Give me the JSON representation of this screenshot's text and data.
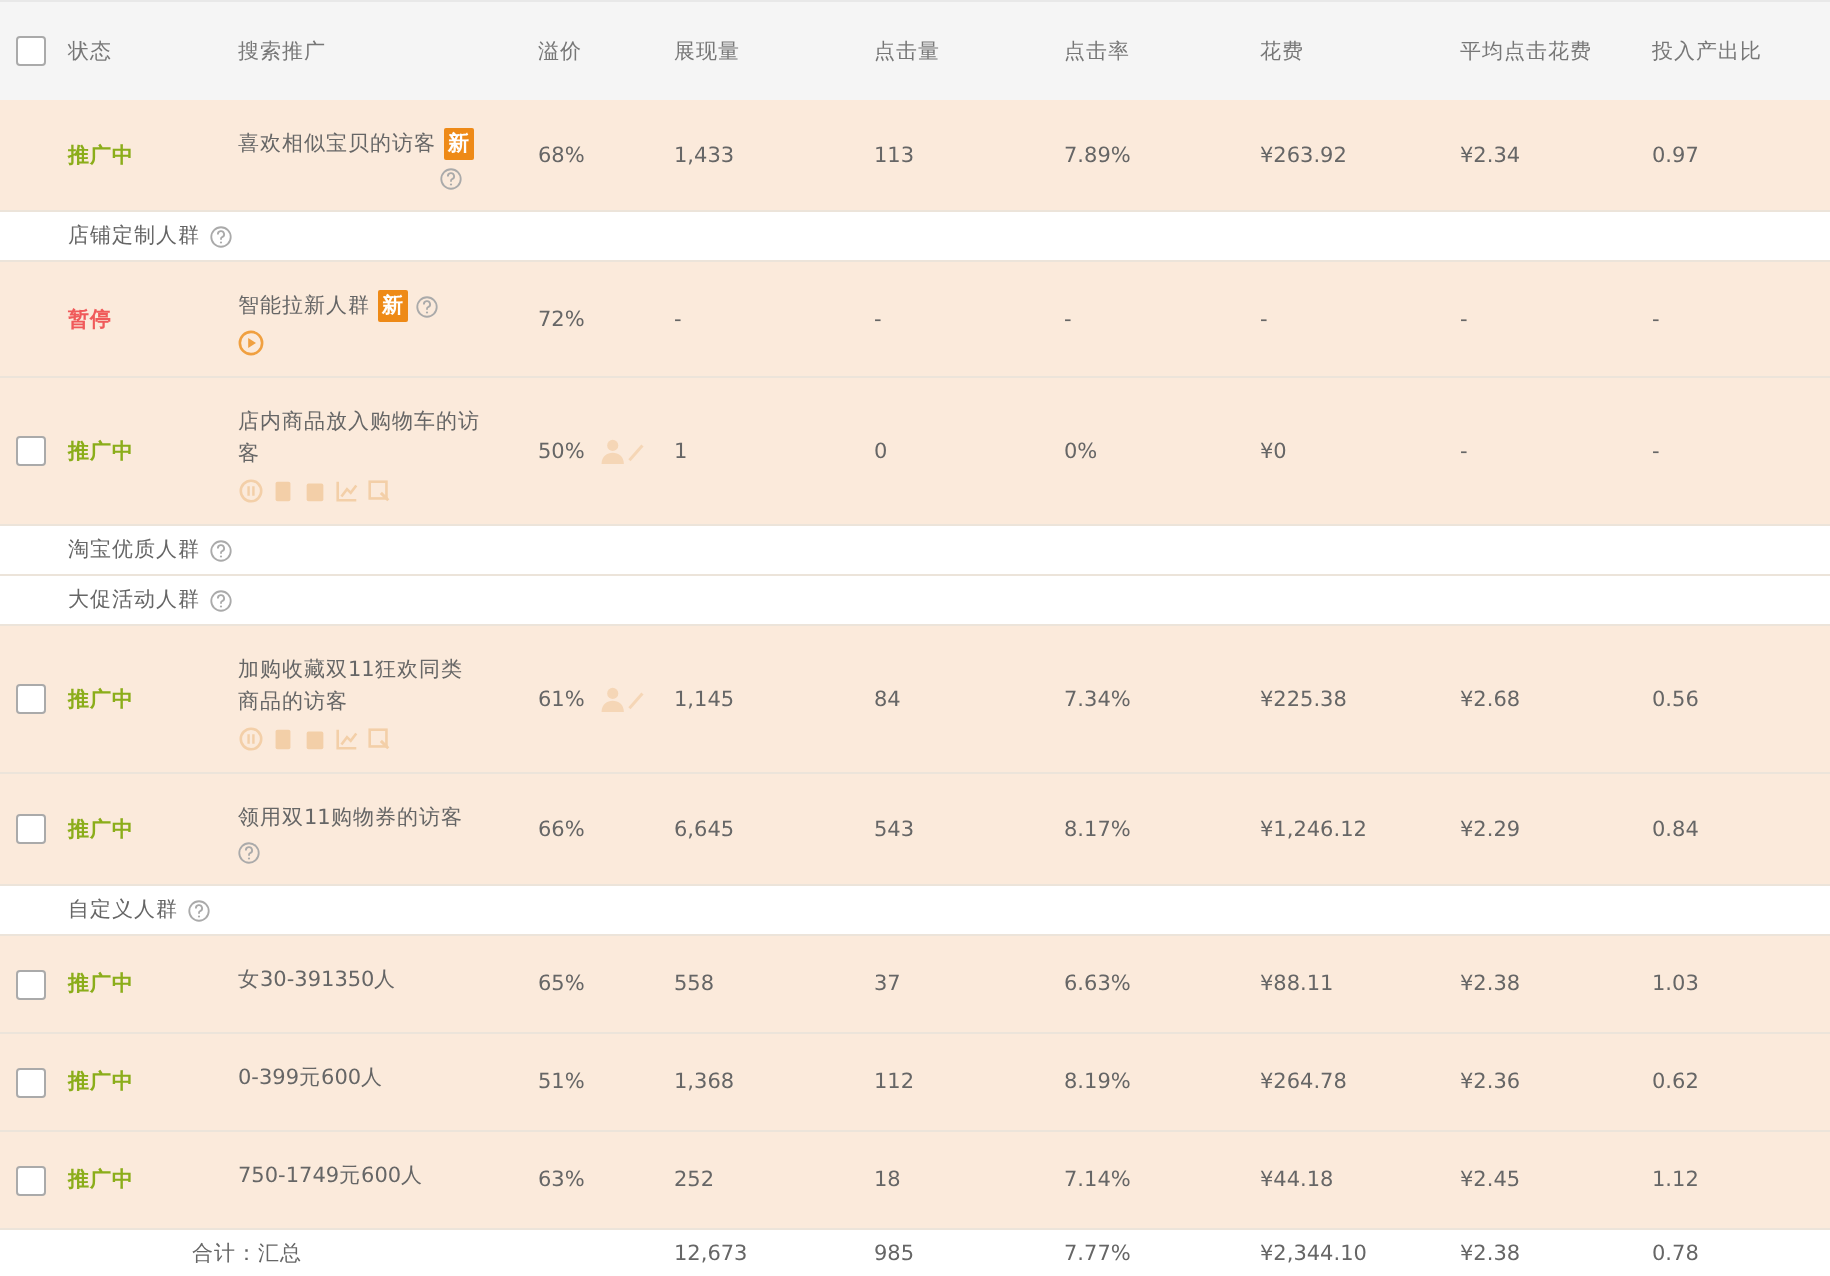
{
  "columns": [
    {
      "label": "状态"
    },
    {
      "label": "搜索推广"
    },
    {
      "label": "溢价"
    },
    {
      "label": "展现量"
    },
    {
      "label": "点击量"
    },
    {
      "label": "点击率"
    },
    {
      "label": "花费"
    },
    {
      "label": "平均点击花费"
    },
    {
      "label": "投入产出比"
    }
  ],
  "header_checkbox": {
    "checked": false
  },
  "rows": [
    {
      "kind": "item",
      "status": "推广中",
      "color": "#8bad1a",
      "name": "喜欢相似宝贝的访客",
      "badge": "新",
      "help": true,
      "premium": "68%",
      "values": [
        "1,433",
        "113",
        "7.89%",
        "¥263.92",
        "¥2.34",
        "0.97"
      ]
    },
    {
      "kind": "group",
      "name": "店铺定制人群",
      "help": true
    },
    {
      "kind": "item",
      "status": "暂停",
      "color": "#f05a5a",
      "name": "智能拉新人群",
      "badge": "新",
      "help": true,
      "play": true,
      "premium": "72%",
      "values": [
        "-",
        "-",
        "-",
        "-",
        "-",
        "-"
      ]
    },
    {
      "kind": "item",
      "checked": false,
      "status": "推广中",
      "color": "#8bad1a",
      "name": "店内商品放入购物车的访客",
      "tools": true,
      "premium": "50%",
      "values": [
        "1",
        "0",
        "0%",
        "¥0",
        "-",
        "-"
      ]
    },
    {
      "kind": "group",
      "name": "淘宝优质人群",
      "help": true
    },
    {
      "kind": "group",
      "name": "大促活动人群",
      "help": true
    },
    {
      "kind": "item",
      "checked": false,
      "status": "推广中",
      "color": "#8bad1a",
      "name": "加购收藏双11狂欢同类商品的访客",
      "tools": true,
      "premium": "61%",
      "values": [
        "1,145",
        "84",
        "7.34%",
        "¥225.38",
        "¥2.68",
        "0.56"
      ]
    },
    {
      "kind": "item",
      "checked": false,
      "status": "推广中",
      "color": "#8bad1a",
      "name": "领用双11购物券的访客",
      "help": true,
      "premium": "66%",
      "values": [
        "6,645",
        "543",
        "8.17%",
        "¥1,246.12",
        "¥2.29",
        "0.84"
      ]
    },
    {
      "kind": "group",
      "name": "自定义人群",
      "help": true
    },
    {
      "kind": "item",
      "checked": false,
      "status": "推广中",
      "color": "#8bad1a",
      "name": "女30-391350人",
      "premium": "65%",
      "values": [
        "558",
        "37",
        "6.63%",
        "¥88.11",
        "¥2.38",
        "1.03"
      ]
    },
    {
      "kind": "item",
      "checked": false,
      "status": "推广中",
      "color": "#8bad1a",
      "name": "0-399元600人",
      "premium": "51%",
      "values": [
        "1,368",
        "112",
        "8.19%",
        "¥264.78",
        "¥2.36",
        "0.62"
      ]
    },
    {
      "kind": "item",
      "checked": false,
      "status": "推广中",
      "color": "#8bad1a",
      "name": "750-1749元600人",
      "premium": "63%",
      "values": [
        "252",
        "18",
        "7.14%",
        "¥44.18",
        "¥2.45",
        "1.12"
      ]
    },
    {
      "kind": "total",
      "name": "合计：汇总",
      "values": [
        "12,673",
        "985",
        "7.77%",
        "¥2,344.10",
        "¥2.38",
        "0.78"
      ]
    }
  ]
}
